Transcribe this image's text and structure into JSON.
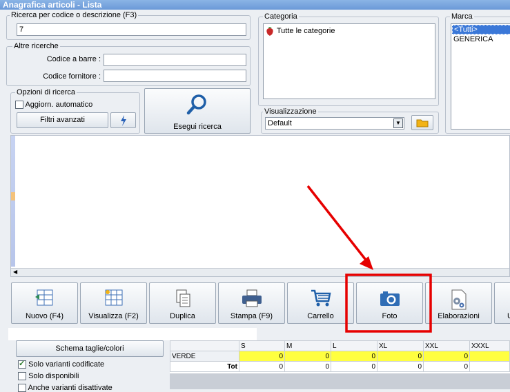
{
  "window": {
    "title": "Anagrafica articoli  - Lista"
  },
  "search": {
    "legend": "Ricerca per codice o descrizione (F3)",
    "value": "7",
    "other_legend": "Altre ricerche",
    "barcode_label": "Codice a barre :",
    "barcode_value": "",
    "supplier_code_label": "Codice fornitore :",
    "supplier_code_value": ""
  },
  "options": {
    "legend": "Opzioni di ricerca",
    "auto_update_label": "Aggiorn. automatico",
    "auto_update_checked": false,
    "advanced_filters_label": "Filtri avanzati",
    "search_button_label": "Esegui ricerca"
  },
  "category": {
    "legend": "Categoria",
    "items": [
      "Tutte le categorie"
    ]
  },
  "view": {
    "legend": "Visualizzazione",
    "selected": "Default"
  },
  "brand": {
    "legend": "Marca",
    "items": [
      "<Tutti>",
      "GENERICA"
    ],
    "selected_index": 0
  },
  "toolbar": {
    "buttons": [
      {
        "label": "Nuovo (F4)",
        "icon": "new-icon"
      },
      {
        "label": "Visualizza (F2)",
        "icon": "grid-view-icon"
      },
      {
        "label": "Duplica",
        "icon": "duplicate-icon"
      },
      {
        "label": "Stampa (F9)",
        "icon": "printer-icon"
      },
      {
        "label": "Carrello",
        "icon": "cart-icon"
      },
      {
        "label": "Foto",
        "icon": "camera-icon"
      },
      {
        "label": "Elaborazioni",
        "icon": "gear-document-icon"
      },
      {
        "label": "U",
        "icon": "more-icon"
      }
    ]
  },
  "variants": {
    "size_color_scheme_label": "Schema taglie/colori",
    "filters": [
      {
        "label": "Solo varianti codificate",
        "checked": true
      },
      {
        "label": "Solo disponibili",
        "checked": false
      },
      {
        "label": "Anche varianti disattivate",
        "checked": false
      }
    ],
    "sizes": [
      "S",
      "M",
      "L",
      "XL",
      "XXL",
      "XXXL"
    ],
    "rows": [
      {
        "color": "VERDE",
        "values": [
          "0",
          "0",
          "0",
          "0",
          "0",
          ""
        ]
      }
    ],
    "total_label": "Tot",
    "totals": [
      "0",
      "0",
      "0",
      "0",
      "0",
      ""
    ]
  },
  "colors": {
    "highlight": "#e60000",
    "yellow_row": "#ffff40",
    "accent": "#1f5fa8"
  }
}
